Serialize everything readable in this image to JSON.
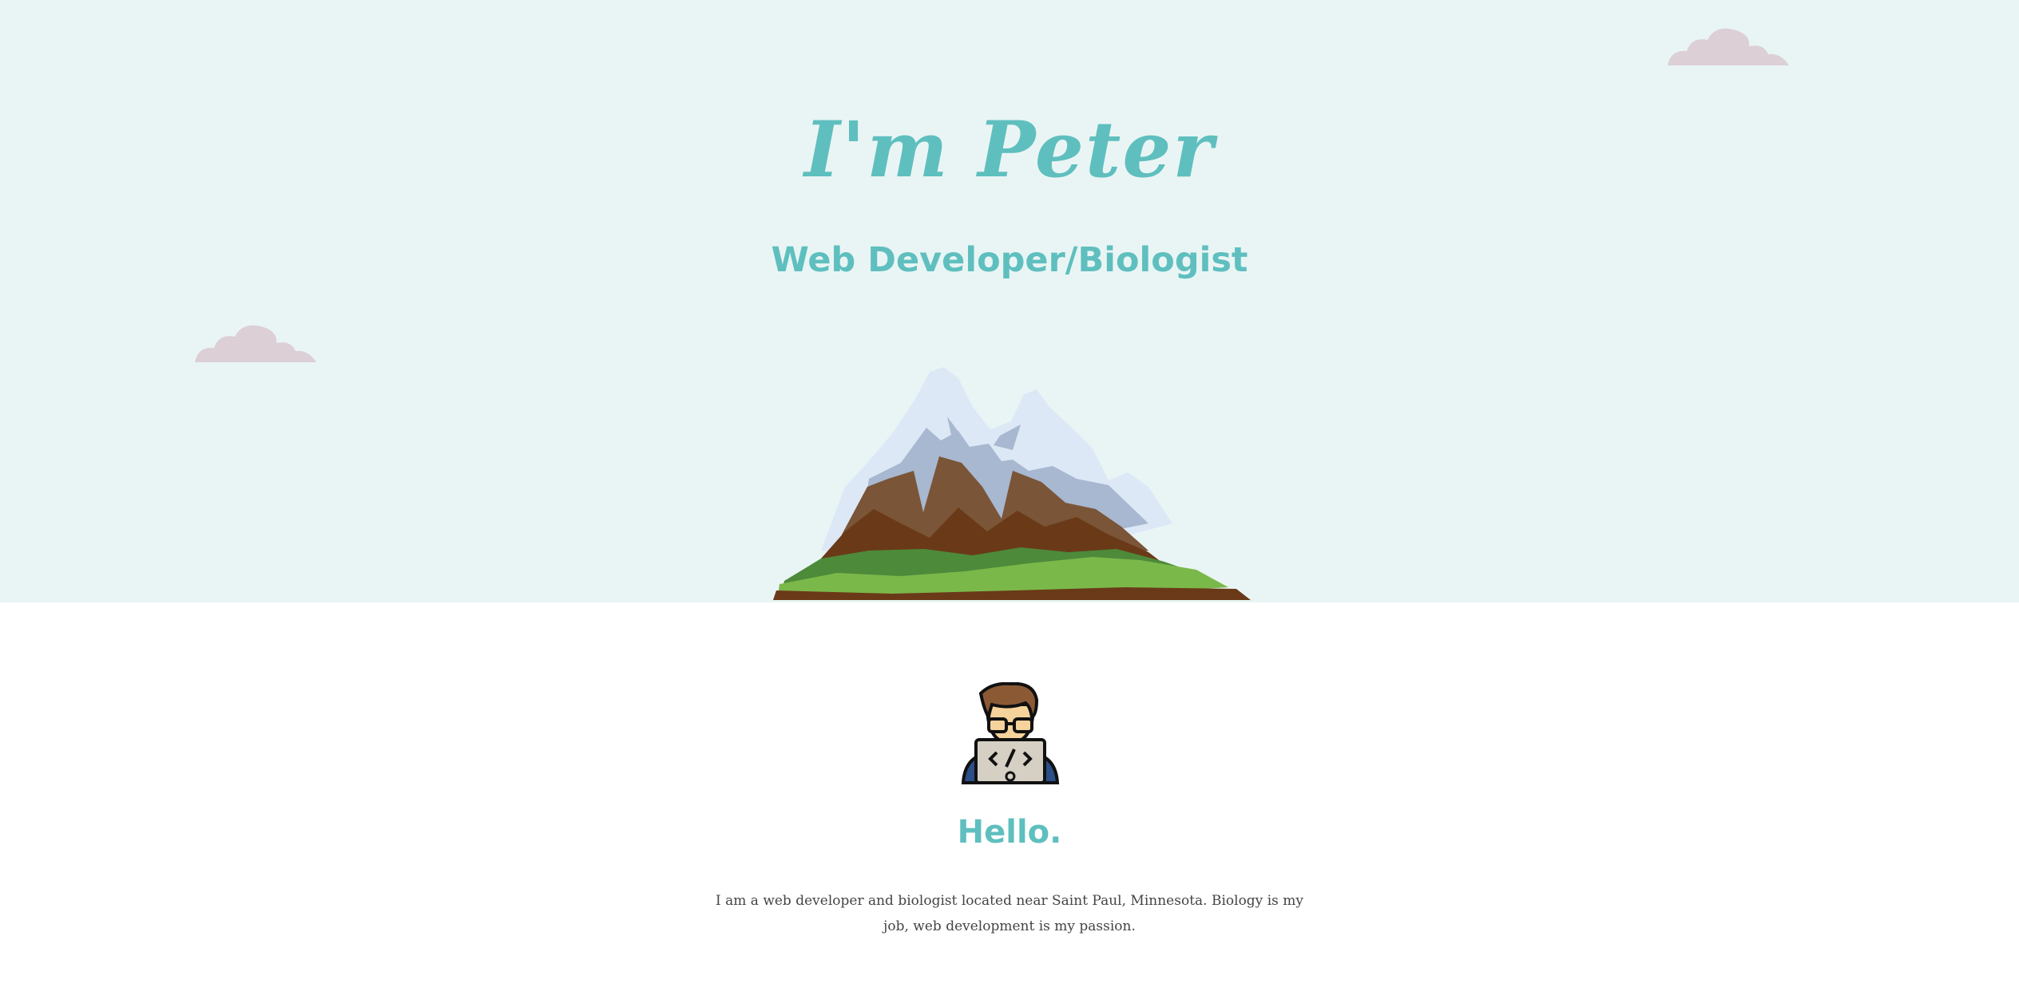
{
  "hero": {
    "title": "I'm Peter",
    "subtitle": "Web Developer/Biologist",
    "background_color": "#e9f5f4",
    "accent_color": "#5fbfbf",
    "cloud_color": "#dccfd6"
  },
  "about": {
    "heading": "Hello.",
    "text": "I am a web developer and biologist located near Saint Paul, Minnesota. Biology is my job, web development is my passion.",
    "avatar_icon": "developer-avatar-icon"
  }
}
